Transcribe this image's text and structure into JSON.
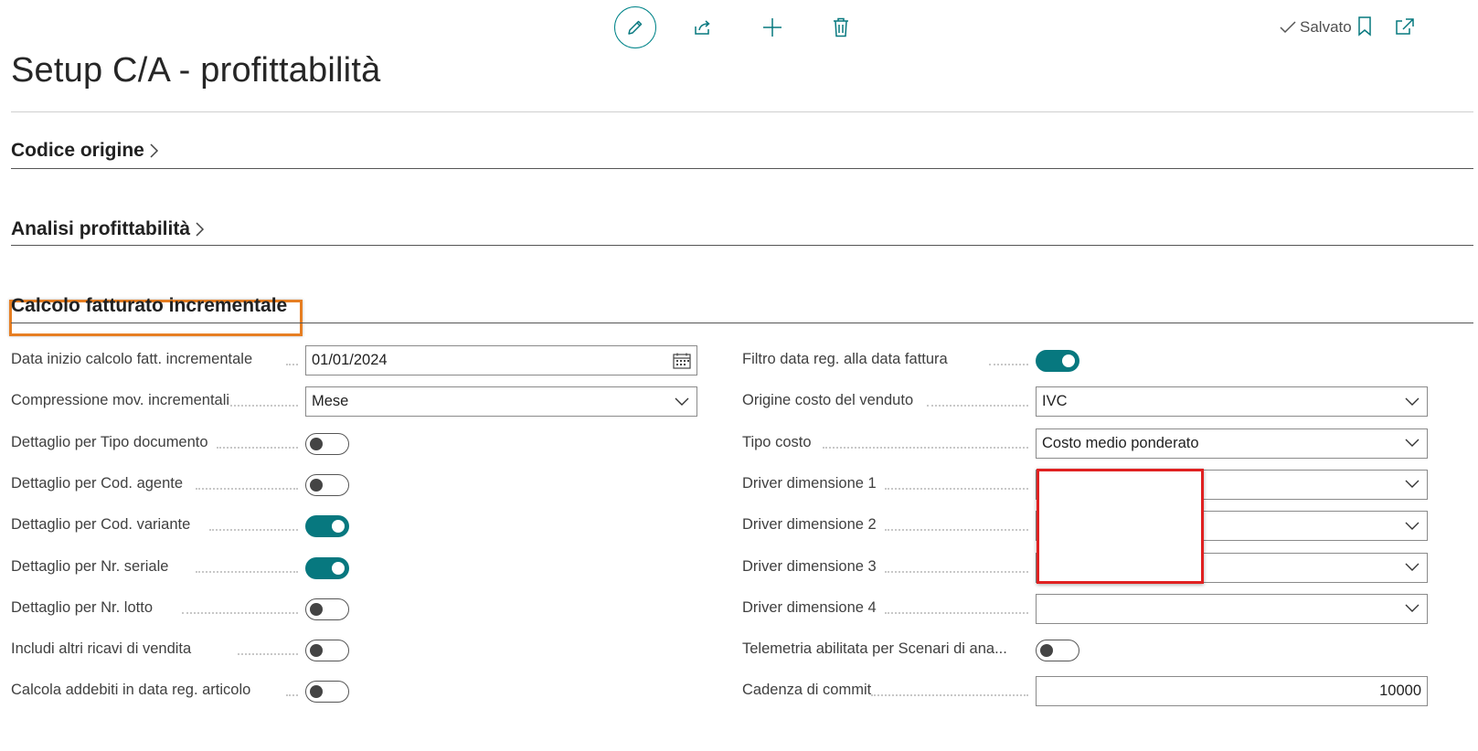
{
  "toolbar": {
    "saved_label": "Salvato",
    "icons": [
      "pencil-icon",
      "share-icon",
      "plus-icon",
      "trash-icon",
      "bookmark-icon",
      "open-new-window-icon"
    ]
  },
  "page": {
    "title": "Setup C/A - profittabilità"
  },
  "sections": {
    "codice_origine": "Codice origine",
    "analisi": "Analisi profittabilità",
    "calcolo": "Calcolo fatturato incrementale"
  },
  "left_fields": [
    {
      "label": "Data inizio calcolo fatt. incrementale",
      "type": "date",
      "value": "01/01/2024"
    },
    {
      "label": "Compressione mov. incrementali",
      "type": "select",
      "value": "Mese"
    },
    {
      "label": "Dettaglio per Tipo documento",
      "type": "toggle",
      "on": false
    },
    {
      "label": "Dettaglio per Cod. agente",
      "type": "toggle",
      "on": false
    },
    {
      "label": "Dettaglio per Cod. variante",
      "type": "toggle",
      "on": true
    },
    {
      "label": "Dettaglio per Nr. seriale",
      "type": "toggle",
      "on": true
    },
    {
      "label": "Dettaglio per Nr. lotto",
      "type": "toggle",
      "on": false
    },
    {
      "label": "Includi altri ricavi di vendita",
      "type": "toggle",
      "on": false
    },
    {
      "label": "Calcola addebiti in data reg. articolo",
      "type": "toggle",
      "on": false
    }
  ],
  "right_fields": [
    {
      "label": "Filtro data reg. alla data fattura",
      "type": "toggle",
      "on": true
    },
    {
      "label": "Origine costo del venduto",
      "type": "select",
      "value": "IVC"
    },
    {
      "label": "Tipo costo",
      "type": "select",
      "value": "Costo medio ponderato"
    },
    {
      "label": "Driver dimensione 1",
      "type": "select",
      "value": ""
    },
    {
      "label": "Driver dimensione 2",
      "type": "select",
      "value": ""
    },
    {
      "label": "Driver dimensione 3",
      "type": "select",
      "value": ""
    },
    {
      "label": "Driver dimensione 4",
      "type": "select",
      "value": ""
    },
    {
      "label": "Telemetria abilitata per Scenari di ana...",
      "type": "toggle",
      "on": false
    },
    {
      "label": "Cadenza di commit",
      "type": "number",
      "value": "10000"
    }
  ],
  "colors": {
    "accent": "#07787f",
    "section_highlight": "#e67e22",
    "redaction_border": "#e02020"
  }
}
